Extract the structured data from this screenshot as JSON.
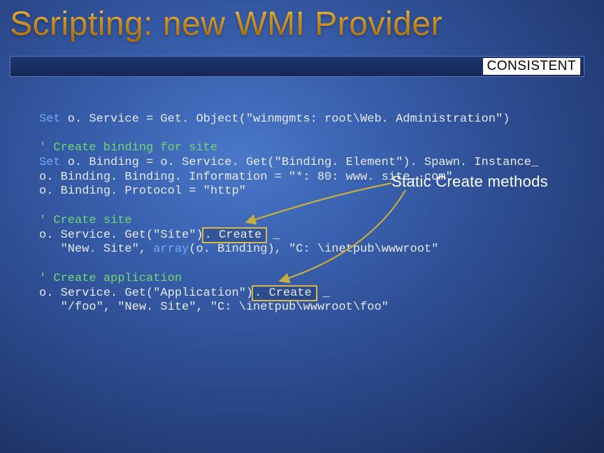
{
  "title": "Scripting: new WMI Provider",
  "badge": "CONSISTENT",
  "annotation": "Static Create methods",
  "code": {
    "l1_a": "Set",
    "l1_b": " o. Service = Get. Object(\"winmgmts: root\\Web. Administration\")",
    "l2": "",
    "l3": "' Create binding for site",
    "l4_a": "Set",
    "l4_b": " o. Binding = o. Service. Get(\"Binding. Element\"). Spawn. Instance_",
    "l5": "o. Binding. Binding. Information = \"*: 80: www. site. com\"",
    "l6": "o. Binding. Protocol = \"http\"",
    "l7": "",
    "l8": "' Create site",
    "l9_a": "o. Service. Get(\"Site\")",
    "l9_hi": ". Create",
    "l9_b": " _",
    "l10_a": "   \"New. Site\", ",
    "l10_b": "array",
    "l10_c": "(o. Binding), \"C: \\inetpub\\wwwroot\"",
    "l11": "",
    "l12": "' Create application",
    "l13_a": "o. Service. Get(\"Application\")",
    "l13_hi": ". Create",
    "l13_b": " _",
    "l14": "   \"/foo\", \"New. Site\", \"C: \\inetpub\\wwwroot\\foo\""
  },
  "colors": {
    "keyword": "#6fa8ff",
    "comment": "#6fd86f",
    "highlight_border": "#d6b84a",
    "arrow": "#c8ae3f"
  }
}
